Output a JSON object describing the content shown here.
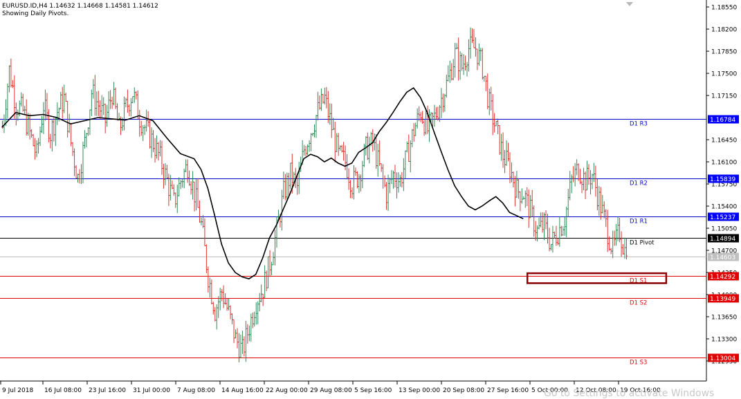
{
  "header": {
    "symbol_line": "EURUSD.ID,H4  1.14632 1.14668 1.14581 1.14612",
    "subtitle": "Showing Daily Pivots."
  },
  "watermark": "Go to Settings to activate Windows",
  "chart_data": {
    "type": "line",
    "subtype": "candlestick",
    "symbol": "EURUSD.ID",
    "timeframe": "H4",
    "last_bar": {
      "open": 1.14632,
      "high": 1.14668,
      "low": 1.14581,
      "close": 1.14612
    },
    "ylim": [
      1.1263,
      1.186
    ],
    "y_ticks": [
      "1.18550",
      "1.18200",
      "1.17850",
      "1.17500",
      "1.17150",
      "1.16450",
      "1.16100",
      "1.15750",
      "1.15400",
      "1.15050",
      "1.14700",
      "1.14350",
      "1.14000",
      "1.13650",
      "1.13300",
      "1.12950"
    ],
    "x_ticks": [
      "9 Jul 2018",
      "16 Jul 08:00",
      "23 Jul 16:00",
      "31 Jul 00:00",
      "7 Aug 08:00",
      "14 Aug 16:00",
      "22 Aug 00:00",
      "29 Aug 08:00",
      "5 Sep 16:00",
      "13 Sep 00:00",
      "20 Sep 08:00",
      "27 Sep 16:00",
      "5 Oct 00:00",
      "12 Oct 08:00",
      "19 Oct 16:00"
    ],
    "levels": [
      {
        "name": "D1 R3",
        "value": 1.16784,
        "label": "1.16784",
        "color": "#0000cd",
        "badge_color": "#0000ff"
      },
      {
        "name": "D1 R2",
        "value": 1.15839,
        "label": "1.15839",
        "color": "#0000cd",
        "badge_color": "#0000ff"
      },
      {
        "name": "D1 R1",
        "value": 1.15237,
        "label": "1.15237",
        "color": "#0000cd",
        "badge_color": "#0000ff"
      },
      {
        "name": "D1 Pivot",
        "value": 1.14894,
        "label": "1.14894",
        "color": "#000000",
        "badge_color": "#000000"
      },
      {
        "name": "D1 S1",
        "value": 1.14292,
        "label": "1.14292",
        "color": "#e00000",
        "badge_color": "#e00000"
      },
      {
        "name": "D1 S2",
        "value": 1.13949,
        "label": "1.13949",
        "color": "#e00000",
        "badge_color": "#e00000"
      },
      {
        "name": "D1 S3",
        "value": 1.13004,
        "label": "1.13004",
        "color": "#e00000",
        "badge_color": "#e00000"
      }
    ],
    "current_price": {
      "value": 1.14603,
      "label": "1.14603",
      "color": "#c0c0c0"
    },
    "price_path": [
      [
        0,
        1.1665
      ],
      [
        1,
        1.1755
      ],
      [
        2,
        1.17
      ],
      [
        3,
        1.169
      ],
      [
        4,
        1.1655
      ],
      [
        5,
        1.162
      ],
      [
        6,
        1.17
      ],
      [
        7,
        1.1655
      ],
      [
        8,
        1.169
      ],
      [
        9,
        1.171
      ],
      [
        10,
        1.164
      ],
      [
        11,
        1.1585
      ],
      [
        12,
        1.164
      ],
      [
        13,
        1.172
      ],
      [
        14,
        1.17
      ],
      [
        15,
        1.1675
      ],
      [
        16,
        1.172
      ],
      [
        17,
        1.166
      ],
      [
        18,
        1.1695
      ],
      [
        19,
        1.172
      ],
      [
        20,
        1.168
      ],
      [
        21,
        1.166
      ],
      [
        22,
        1.164
      ],
      [
        23,
        1.1615
      ],
      [
        24,
        1.158
      ],
      [
        25,
        1.1545
      ],
      [
        26,
        1.158
      ],
      [
        27,
        1.1605
      ],
      [
        28,
        1.156
      ],
      [
        29,
        1.151
      ],
      [
        30,
        1.143
      ],
      [
        31,
        1.1375
      ],
      [
        32,
        1.1405
      ],
      [
        33,
        1.137
      ],
      [
        34,
        1.133
      ],
      [
        35,
        1.131
      ],
      [
        36,
        1.135
      ],
      [
        37,
        1.139
      ],
      [
        38,
        1.141
      ],
      [
        39,
        1.145
      ],
      [
        40,
        1.15
      ],
      [
        41,
        1.156
      ],
      [
        42,
        1.159
      ],
      [
        43,
        1.157
      ],
      [
        44,
        1.163
      ],
      [
        45,
        1.166
      ],
      [
        46,
        1.169
      ],
      [
        47,
        1.171
      ],
      [
        48,
        1.1665
      ],
      [
        49,
        1.162
      ],
      [
        50,
        1.161
      ],
      [
        51,
        1.1575
      ],
      [
        52,
        1.159
      ],
      [
        53,
        1.163
      ],
      [
        54,
        1.164
      ],
      [
        55,
        1.16
      ],
      [
        56,
        1.156
      ],
      [
        57,
        1.159
      ],
      [
        58,
        1.158
      ],
      [
        59,
        1.162
      ],
      [
        60,
        1.166
      ],
      [
        61,
        1.169
      ],
      [
        62,
        1.166
      ],
      [
        63,
        1.168
      ],
      [
        64,
        1.171
      ],
      [
        65,
        1.174
      ],
      [
        66,
        1.178
      ],
      [
        67,
        1.176
      ],
      [
        68,
        1.179
      ],
      [
        69,
        1.179
      ],
      [
        70,
        1.176
      ],
      [
        71,
        1.17
      ],
      [
        72,
        1.166
      ],
      [
        73,
        1.162
      ],
      [
        74,
        1.16
      ],
      [
        75,
        1.1565
      ],
      [
        76,
        1.156
      ],
      [
        77,
        1.153
      ],
      [
        78,
        1.15
      ],
      [
        79,
        1.151
      ],
      [
        80,
        1.148
      ],
      [
        81,
        1.15
      ],
      [
        82,
        1.152
      ],
      [
        83,
        1.158
      ],
      [
        84,
        1.16
      ],
      [
        85,
        1.158
      ],
      [
        86,
        1.159
      ],
      [
        87,
        1.155
      ],
      [
        88,
        1.151
      ],
      [
        89,
        1.147
      ],
      [
        90,
        1.15
      ],
      [
        91,
        1.146
      ]
    ],
    "moving_average": [
      [
        0,
        1.1665
      ],
      [
        2,
        1.1688
      ],
      [
        4,
        1.1683
      ],
      [
        6,
        1.1685
      ],
      [
        8,
        1.168
      ],
      [
        10,
        1.167
      ],
      [
        12,
        1.1675
      ],
      [
        14,
        1.168
      ],
      [
        16,
        1.1678
      ],
      [
        18,
        1.1676
      ],
      [
        20,
        1.1683
      ],
      [
        22,
        1.1675
      ],
      [
        24,
        1.1648
      ],
      [
        26,
        1.1623
      ],
      [
        28,
        1.1615
      ],
      [
        29,
        1.1598
      ],
      [
        30,
        1.1568
      ],
      [
        31,
        1.1525
      ],
      [
        32,
        1.148
      ],
      [
        33,
        1.145
      ],
      [
        34,
        1.1435
      ],
      [
        35,
        1.1428
      ],
      [
        36,
        1.1425
      ],
      [
        37,
        1.1432
      ],
      [
        38,
        1.1458
      ],
      [
        39,
        1.149
      ],
      [
        40,
        1.151
      ],
      [
        41,
        1.1535
      ],
      [
        42,
        1.156
      ],
      [
        43,
        1.1588
      ],
      [
        44,
        1.1615
      ],
      [
        45,
        1.1622
      ],
      [
        46,
        1.1618
      ],
      [
        47,
        1.161
      ],
      [
        48,
        1.1616
      ],
      [
        49,
        1.1608
      ],
      [
        50,
        1.1603
      ],
      [
        51,
        1.1608
      ],
      [
        52,
        1.1625
      ],
      [
        53,
        1.1632
      ],
      [
        54,
        1.164
      ],
      [
        55,
        1.1658
      ],
      [
        56,
        1.1672
      ],
      [
        57,
        1.1688
      ],
      [
        58,
        1.1705
      ],
      [
        59,
        1.172
      ],
      [
        60,
        1.1727
      ],
      [
        61,
        1.1712
      ],
      [
        62,
        1.1688
      ],
      [
        63,
        1.1657
      ],
      [
        64,
        1.1627
      ],
      [
        65,
        1.1598
      ],
      [
        66,
        1.1572
      ],
      [
        67,
        1.1555
      ],
      [
        68,
        1.154
      ],
      [
        69,
        1.1534
      ],
      [
        70,
        1.154
      ],
      [
        71,
        1.1548
      ],
      [
        72,
        1.1555
      ],
      [
        73,
        1.1545
      ],
      [
        74,
        1.153
      ],
      [
        75,
        1.1525
      ],
      [
        76,
        1.152
      ]
    ],
    "ma_x_max": 91,
    "annotations": [
      {
        "type": "rectangle",
        "y_top": 1.14338,
        "y_bottom": 1.14181,
        "x_from": 77,
        "x_to": 92,
        "color": "#8b0000"
      }
    ],
    "colors": {
      "bull": "#2e8b57",
      "bear": "#e03030",
      "ma": "#000000"
    }
  }
}
